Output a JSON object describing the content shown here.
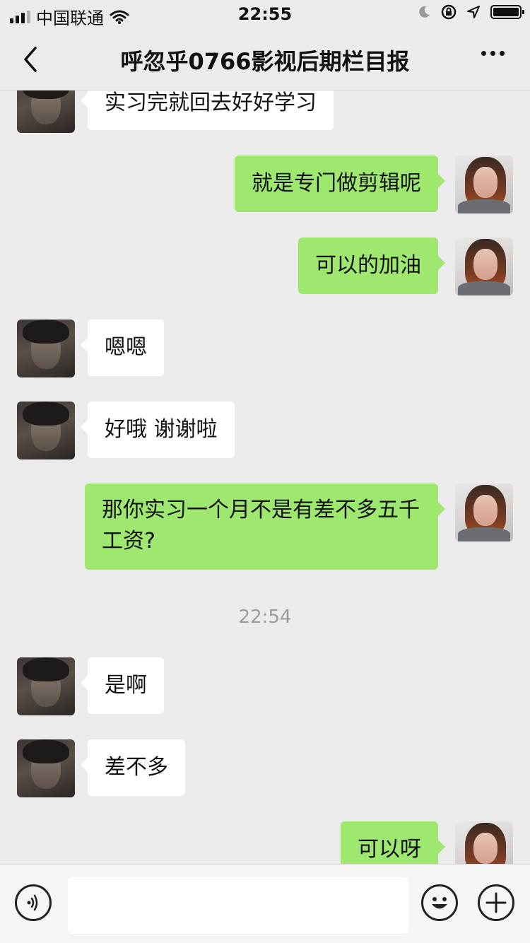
{
  "status_bar": {
    "carrier": "中国联通",
    "time": "22:55"
  },
  "nav": {
    "title": "呼忽乎0766影视后期栏目报"
  },
  "chat": {
    "messages": [
      {
        "side": "in",
        "text": "实习完就回去好好学习"
      },
      {
        "side": "out",
        "text": "就是专门做剪辑呢"
      },
      {
        "side": "out",
        "text": "可以的加油"
      },
      {
        "side": "in",
        "text": "嗯嗯"
      },
      {
        "side": "in",
        "text": "好哦 谢谢啦"
      },
      {
        "side": "out",
        "text": "那你实习一个月不是有差不多五千工资?"
      },
      {
        "side": "in",
        "text": "是啊"
      },
      {
        "side": "in",
        "text": "差不多"
      },
      {
        "side": "out",
        "text": "可以呀"
      }
    ],
    "timestamp": "22:54"
  },
  "input_bar": {
    "icons": [
      "voice-icon",
      "emoji-icon",
      "plus-icon"
    ]
  },
  "colors": {
    "background": "#ebebeb",
    "outgoing_bubble": "#9fe870",
    "incoming_bubble": "#ffffff"
  }
}
